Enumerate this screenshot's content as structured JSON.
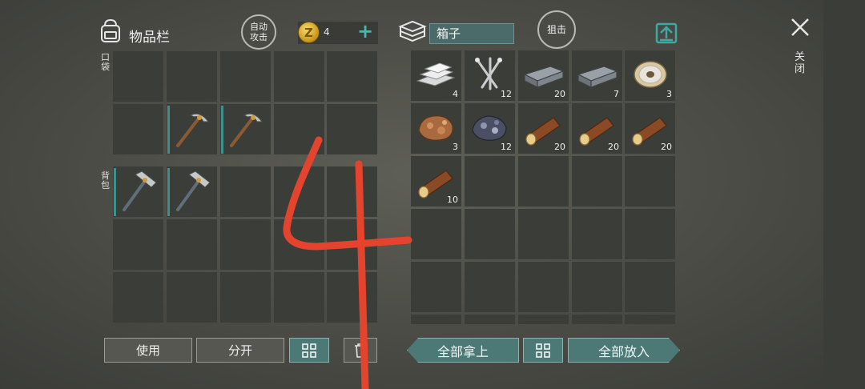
{
  "header": {
    "inventory_title": "物品栏",
    "auto_attack_label": "自动\n攻击",
    "coin_count": "4",
    "coin_plus": "+",
    "container_name": "箱子",
    "snipe_label": "狙击",
    "close_label": "关闭"
  },
  "inventory": {
    "pocket_label": "口袋",
    "backpack_label": "背包",
    "pocket_slots": [
      null,
      null,
      null,
      null,
      null,
      null,
      {
        "item": "pickaxe-icon"
      },
      {
        "item": "pickaxe-icon"
      },
      null,
      null
    ],
    "backpack_slots": [
      {
        "item": "hammer-icon"
      },
      {
        "item": "hammer-icon"
      },
      null,
      null,
      null,
      null,
      null,
      null,
      null,
      null,
      null,
      null,
      null,
      null,
      null
    ]
  },
  "container": {
    "slots": [
      {
        "item": "iron-bar-icon",
        "qty": "4"
      },
      {
        "item": "nails-icon",
        "qty": "12"
      },
      {
        "item": "metal-ingot-icon",
        "qty": "20"
      },
      {
        "item": "metal-ingot-icon",
        "qty": "7"
      },
      {
        "item": "wire-spool-icon",
        "qty": "3"
      },
      {
        "item": "copper-ore-icon",
        "qty": "3"
      },
      {
        "item": "iron-ore-icon",
        "qty": "12"
      },
      {
        "item": "log-icon",
        "qty": "20"
      },
      {
        "item": "log-icon",
        "qty": "20"
      },
      {
        "item": "log-icon",
        "qty": "20"
      },
      {
        "item": "log-icon",
        "qty": "10"
      }
    ]
  },
  "footer": {
    "use_label": "使用",
    "split_label": "分开",
    "take_all_label": "全部拿上",
    "put_all_label": "全部放入"
  },
  "annotation": {
    "text": "4",
    "color": "#e4442d"
  }
}
